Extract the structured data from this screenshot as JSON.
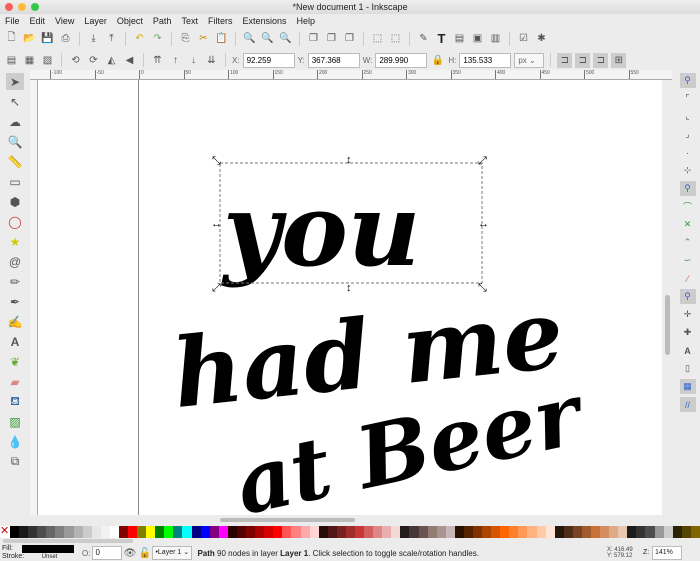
{
  "window": {
    "title": "*New document 1 - Inkscape"
  },
  "menu": [
    "File",
    "Edit",
    "View",
    "Layer",
    "Object",
    "Path",
    "Text",
    "Filters",
    "Extensions",
    "Help"
  ],
  "toolbar": {
    "x_label": "X:",
    "x": "92.259",
    "y_label": "Y:",
    "y": "367.368",
    "w_label": "W:",
    "w": "289.990",
    "h_label": "H:",
    "h": "135.533",
    "unit": "px"
  },
  "ruler_ticks": [
    "-100",
    "-50",
    "0",
    "50",
    "100",
    "150",
    "200",
    "250",
    "300",
    "350",
    "400",
    "450",
    "500",
    "550"
  ],
  "artwork": {
    "line1": "you",
    "line2": "had me",
    "line3": "at Beer"
  },
  "palette": [
    "#000",
    "#1a1a1a",
    "#333",
    "#4d4d4d",
    "#666",
    "#808080",
    "#999",
    "#b3b3b3",
    "#ccc",
    "#e6e6e6",
    "#f2f2f2",
    "#fff",
    "#800000",
    "#f00",
    "#808000",
    "#ff0",
    "#008000",
    "#0f0",
    "#008080",
    "#0ff",
    "#000080",
    "#00f",
    "#800080",
    "#f0f",
    "#2b0000",
    "#550000",
    "#800000",
    "#aa0000",
    "#d40000",
    "#f00",
    "#ff5555",
    "#ff8080",
    "#ffaaaa",
    "#ffd5d5",
    "#280b0b",
    "#501616",
    "#782121",
    "#a02c2c",
    "#c83737",
    "#d35f5f",
    "#de8787",
    "#e9afaf",
    "#f4d7d7",
    "#241c1c",
    "#483737",
    "#6c5353",
    "#917c6f",
    "#ac9393",
    "#c8b7b7",
    "#2b1100",
    "#552200",
    "#803300",
    "#aa4400",
    "#d45500",
    "#f60",
    "#ff7f2a",
    "#f95",
    "#ffb380",
    "#ffccaa",
    "#ffe6d5",
    "#28170b",
    "#502d16",
    "#784421",
    "#a05a2c",
    "#c87137",
    "#d38d5f",
    "#deaa87",
    "#e9c6af",
    "#1c1c1c",
    "#333",
    "#4d4d4d",
    "#999",
    "#ccc",
    "#2b2200",
    "#554400",
    "#806600"
  ],
  "status": {
    "fill_label": "Fill:",
    "stroke_label": "Stroke:",
    "stroke_value": "Unset",
    "opacity_label": "O:",
    "opacity": "0",
    "layer": "•Layer 1",
    "message_type": "Path",
    "message": " 90 nodes in layer ",
    "message_layer": "Layer 1",
    "message_tail": ". Click selection to toggle scale/rotation handles.",
    "cursor_x": "X: 416.49",
    "cursor_y": "Y: 579.12",
    "zoom_label": "Z:",
    "zoom": "141%"
  }
}
